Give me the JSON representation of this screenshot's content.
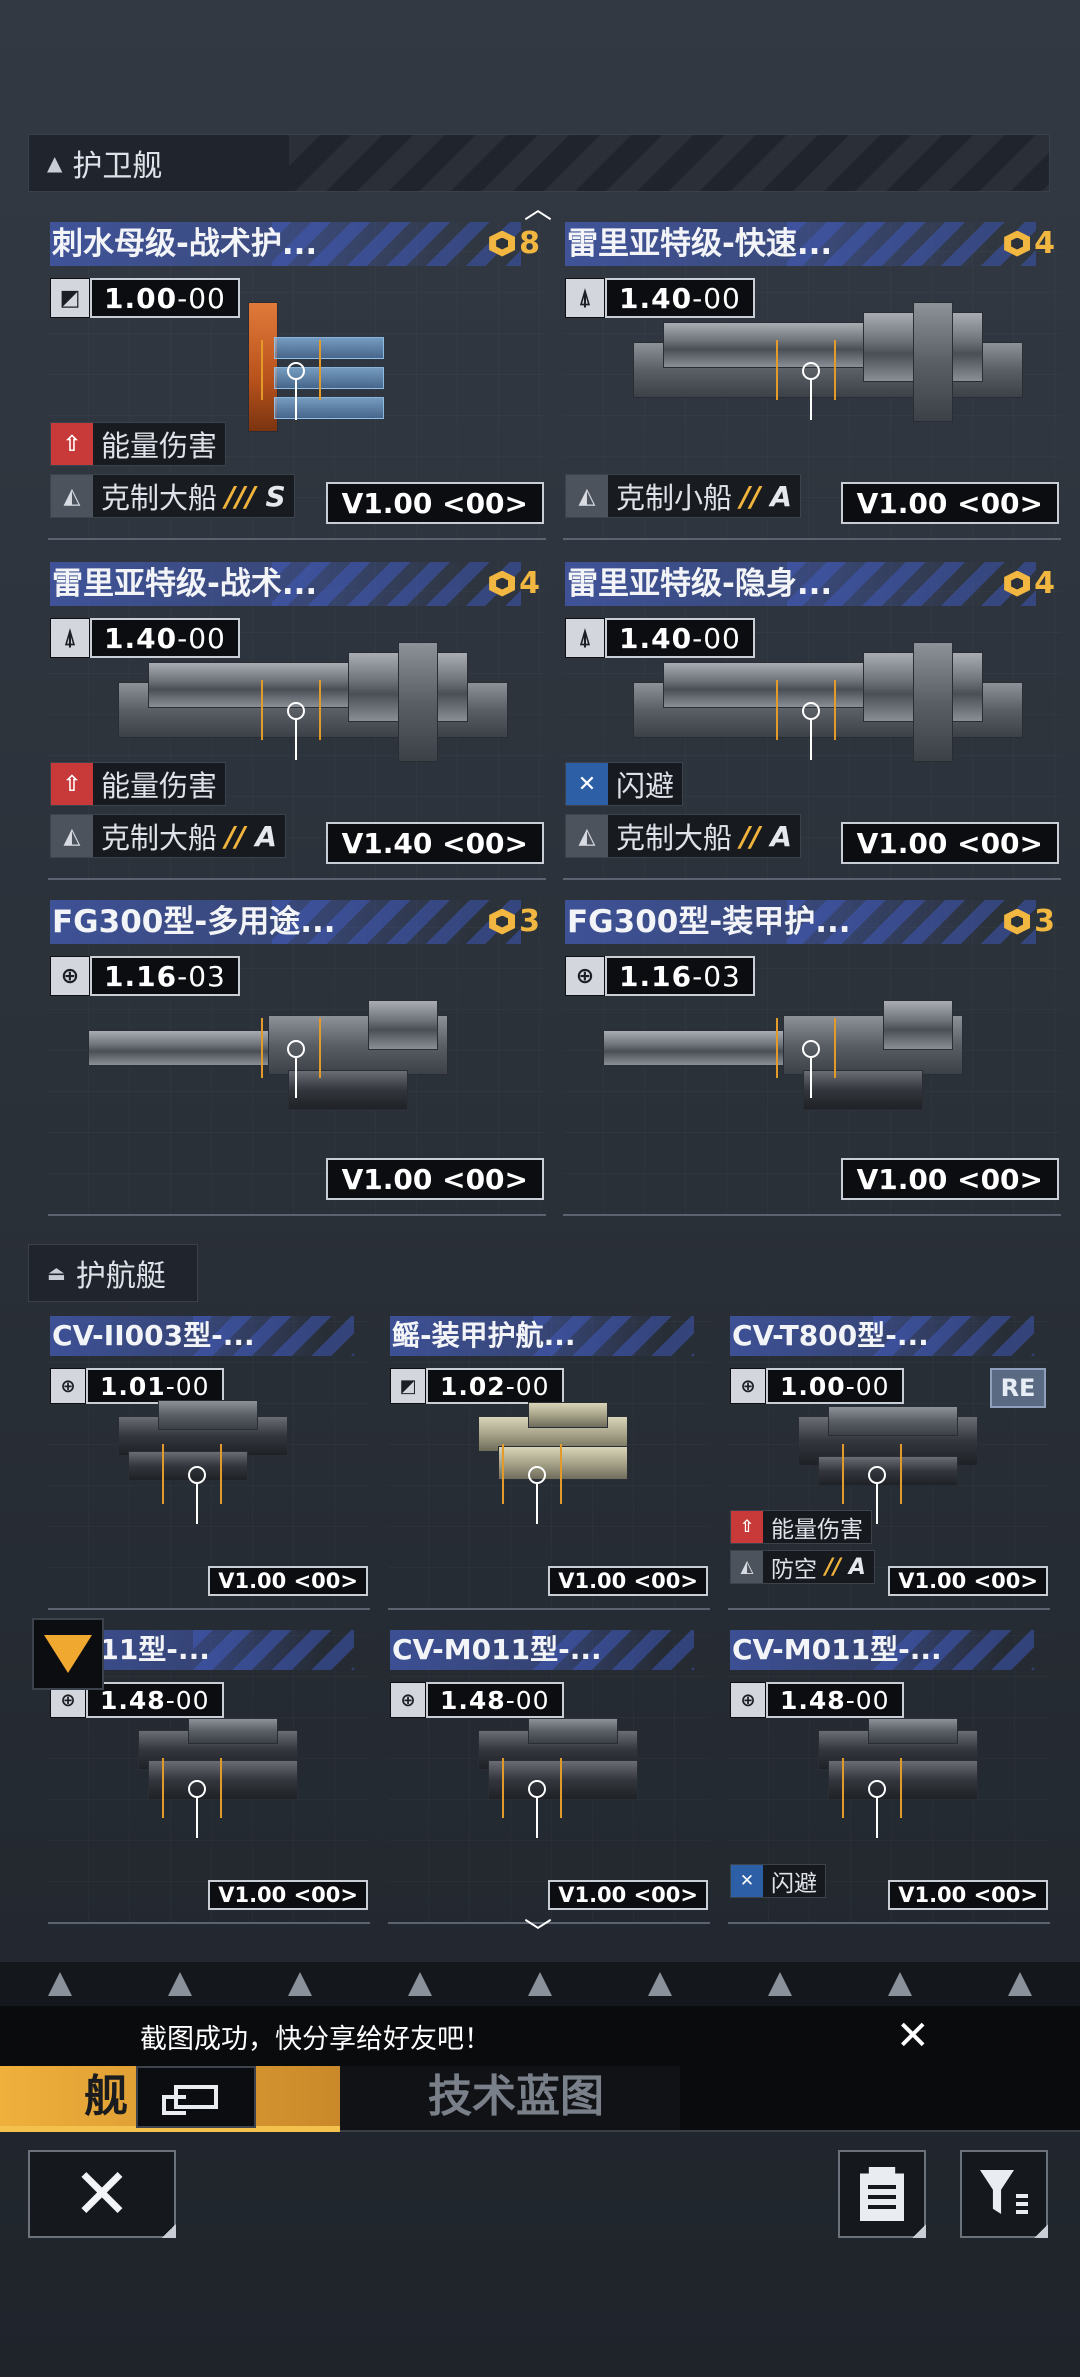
{
  "sections": {
    "frigates": {
      "title": "护卫舰",
      "icon": "triangle-up-icon"
    },
    "corvettes": {
      "title": "护航艇",
      "icon": "layers-icon"
    }
  },
  "frigate_cards": [
    {
      "name": "刺水母级-战术护...",
      "cost": "8",
      "version": "1.00",
      "build": "00",
      "ver_icon": "speed-icon",
      "attrs": [
        {
          "icon": "arrow-up-icon",
          "text": "能量伤害",
          "grade": ""
        },
        {
          "icon": "counter-icon",
          "text": "克制大船",
          "grade": "S",
          "slashes": "///"
        }
      ],
      "badge": "V1.00 <00>"
    },
    {
      "name": "雷里亚特级-快速...",
      "cost": "4",
      "version": "1.40",
      "build": "00",
      "ver_icon": "rocket-icon",
      "attrs": [
        {
          "icon": "counter-icon",
          "text": "克制小船",
          "grade": "A",
          "slashes": "//"
        }
      ],
      "badge": "V1.00 <00>"
    },
    {
      "name": "雷里亚特级-战术...",
      "cost": "4",
      "version": "1.40",
      "build": "00",
      "ver_icon": "rocket-icon",
      "attrs": [
        {
          "icon": "arrow-up-icon",
          "text": "能量伤害",
          "grade": ""
        },
        {
          "icon": "counter-icon",
          "text": "克制大船",
          "grade": "A",
          "slashes": "//"
        }
      ],
      "badge": "V1.40 <00>"
    },
    {
      "name": "雷里亚特级-隐身...",
      "cost": "4",
      "version": "1.40",
      "build": "00",
      "ver_icon": "rocket-icon",
      "attrs": [
        {
          "icon": "dodge-icon",
          "text": "闪避",
          "grade": ""
        },
        {
          "icon": "counter-icon",
          "text": "克制大船",
          "grade": "A",
          "slashes": "//"
        }
      ],
      "badge": "V1.00 <00>"
    },
    {
      "name": "FG300型-多用途...",
      "cost": "3",
      "version": "1.16",
      "build": "03",
      "ver_icon": "globe-icon",
      "attrs": [],
      "badge": "V1.00 <00>"
    },
    {
      "name": "FG300型-装甲护...",
      "cost": "3",
      "version": "1.16",
      "build": "03",
      "ver_icon": "globe-icon",
      "attrs": [],
      "badge": "V1.00 <00>"
    }
  ],
  "corvette_cards": [
    {
      "name": "CV-II003型-...",
      "version": "1.01",
      "build": "00",
      "ver_icon": "globe-icon",
      "attrs": [],
      "badge": "V1.00 <00>"
    },
    {
      "name": "鳐-装甲护航...",
      "version": "1.02",
      "build": "00",
      "ver_icon": "speed-icon",
      "attrs": [],
      "badge": "V1.00 <00>"
    },
    {
      "name": "CV-T800型-...",
      "version": "1.00",
      "build": "00",
      "ver_icon": "globe-icon",
      "tag": "RE",
      "attrs": [
        {
          "icon": "arrow-up-icon",
          "text": "能量伤害",
          "grade": ""
        },
        {
          "icon": "counter-icon",
          "text": "防空",
          "grade": "A",
          "slashes": "//"
        }
      ],
      "badge": "V1.00 <00>"
    },
    {
      "name": "M011型-...",
      "version": "1.48",
      "build": "00",
      "ver_icon": "globe-icon",
      "attrs": [],
      "badge": "V1.00 <00>"
    },
    {
      "name": "CV-M011型-...",
      "version": "1.48",
      "build": "00",
      "ver_icon": "globe-icon",
      "attrs": [],
      "badge": "V1.00 <00>"
    },
    {
      "name": "CV-M011型-...",
      "version": "1.48",
      "build": "00",
      "ver_icon": "globe-icon",
      "attrs": [
        {
          "icon": "dodge-icon",
          "text": "闪避",
          "grade": ""
        }
      ],
      "badge": "V1.00 <00>"
    }
  ],
  "toast": {
    "message": "截图成功，快分享给好友吧！",
    "close": "✕"
  },
  "tabs": {
    "active": "舰",
    "inactive": "技术蓝图"
  },
  "buttons": {
    "close": "✕"
  },
  "scroll": {
    "up": "︿",
    "down": "﹀"
  },
  "colors": {
    "accent": "#f0b03c",
    "cost": "#f1b740",
    "damage": "#c83a3a",
    "dodge": "#2d5fa6",
    "title_bar": "#465fbe"
  }
}
